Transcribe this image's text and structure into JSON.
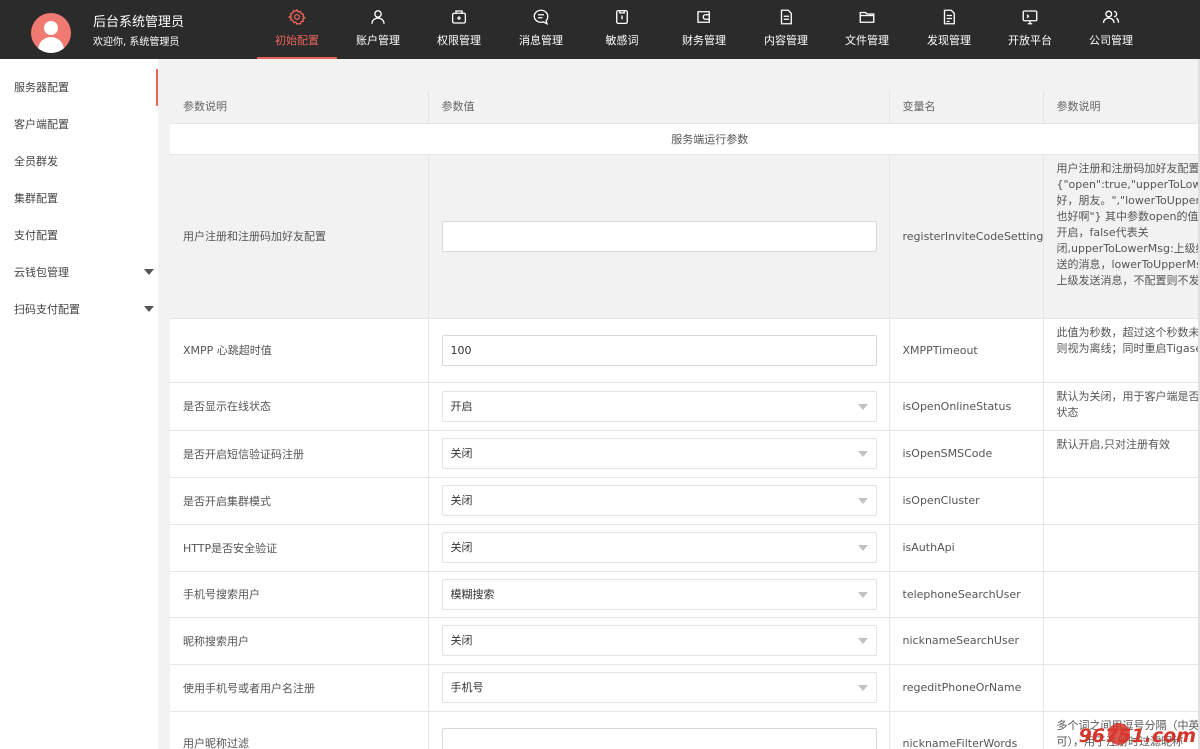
{
  "header": {
    "title": "后台系统管理员",
    "welcome": "欢迎你,  系统管理员",
    "nav": [
      {
        "label": "初始配置",
        "icon": "gear-icon",
        "active": true
      },
      {
        "label": "账户管理",
        "icon": "user-icon"
      },
      {
        "label": "权限管理",
        "icon": "permission-icon"
      },
      {
        "label": "消息管理",
        "icon": "message-icon"
      },
      {
        "label": "敏感词",
        "icon": "sensitive-word-icon"
      },
      {
        "label": "财务管理",
        "icon": "wallet-icon"
      },
      {
        "label": "内容管理",
        "icon": "document-icon"
      },
      {
        "label": "文件管理",
        "icon": "folder-icon"
      },
      {
        "label": "发现管理",
        "icon": "discover-icon"
      },
      {
        "label": "开放平台",
        "icon": "monitor-icon"
      },
      {
        "label": "公司管理",
        "icon": "users-icon"
      }
    ]
  },
  "sidebar": {
    "items": [
      {
        "label": "服务器配置",
        "active": true
      },
      {
        "label": "客户端配置"
      },
      {
        "label": "全员群发"
      },
      {
        "label": "集群配置"
      },
      {
        "label": "支付配置"
      },
      {
        "label": "云钱包管理",
        "expandable": true
      },
      {
        "label": "扫码支付配置",
        "expandable": true
      }
    ]
  },
  "table": {
    "headers": [
      "参数说明",
      "参数值",
      "变量名",
      "参数说明"
    ],
    "section_title": "服务端运行参数",
    "rows": [
      {
        "label": "用户注册和注册码加好友配置",
        "type": "input",
        "value": "",
        "var": "registerInviteCodeSetting",
        "desc": "用户注册和注册码加好友配置示例\n{\"open\":true,\"upperToLowerMsg\":\"你好，朋友。\",\"lowerToUpperMsg\":\"你也好啊\"} 其中参数open的值true代表开启，false代表关闭,upperToLowerMsg:上级给下级发送的消息，lowerToUpperMsg:下级给上级发送消息，不配置则不发送"
      },
      {
        "label": "XMPP 心跳超时值",
        "type": "input",
        "value": "100",
        "var": "XMPPTimeout",
        "desc": "此值为秒数，超过这个秒数未收到心跳则视为离线；同时重启Tigase后生效"
      },
      {
        "label": "是否显示在线状态",
        "type": "select",
        "value": "开启",
        "var": "isOpenOnlineStatus",
        "desc": "默认为关闭，用于客户端是否显示在线状态"
      },
      {
        "label": "是否开启短信验证码注册",
        "type": "select",
        "value": "关闭",
        "var": "isOpenSMSCode",
        "desc": "默认开启,只对注册有效"
      },
      {
        "label": "是否开启集群模式",
        "type": "select",
        "value": "关闭",
        "var": "isOpenCluster",
        "desc": ""
      },
      {
        "label": "HTTP是否安全验证",
        "type": "select",
        "value": "关闭",
        "var": "isAuthApi",
        "desc": ""
      },
      {
        "label": "手机号搜索用户",
        "type": "select",
        "value": "模糊搜索",
        "var": "telephoneSearchUser",
        "desc": ""
      },
      {
        "label": "昵称搜索用户",
        "type": "select",
        "value": "关闭",
        "var": "nicknameSearchUser",
        "desc": ""
      },
      {
        "label": "使用手机号或者用户名注册",
        "type": "select",
        "value": "手机号",
        "var": "regeditPhoneOrName",
        "desc": ""
      },
      {
        "label": "用户昵称过滤",
        "type": "input",
        "value": "",
        "var": "nicknameFilterWords",
        "desc": "多个词之间用逗号分隔（中英文逗号均可），用于注册时过滤昵称"
      }
    ]
  },
  "watermark": "96751.com"
}
